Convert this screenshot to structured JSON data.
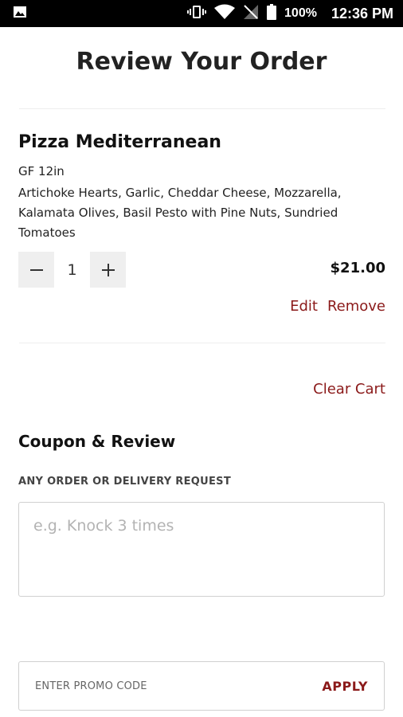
{
  "status_bar": {
    "battery": "100%",
    "time": "12:36 PM",
    "icons": [
      "image-icon",
      "vibrate-icon",
      "wifi-icon",
      "signal-off-icon",
      "battery-icon"
    ]
  },
  "title": "Review Your Order",
  "cart": {
    "item": {
      "name": "Pizza Mediterranean",
      "size": "GF 12in",
      "toppings": "Artichoke Hearts, Garlic, Cheddar Cheese, Mozzarella, Kalamata Olives, Basil Pesto with Pine Nuts, Sundried Tomatoes",
      "quantity": "1",
      "price": "$21.00",
      "edit_label": "Edit",
      "remove_label": "Remove"
    },
    "clear_cart_label": "Clear Cart"
  },
  "coupon_review": {
    "title": "Coupon & Review",
    "request_label": "ANY ORDER OR DELIVERY REQUEST",
    "request_placeholder": "e.g. Knock 3 times",
    "promo_placeholder": "ENTER PROMO CODE",
    "apply_label": "APPLY"
  },
  "colors": {
    "accent": "#8b1a1a",
    "status_bar": "#000000",
    "qty_button_bg": "#efefef"
  }
}
